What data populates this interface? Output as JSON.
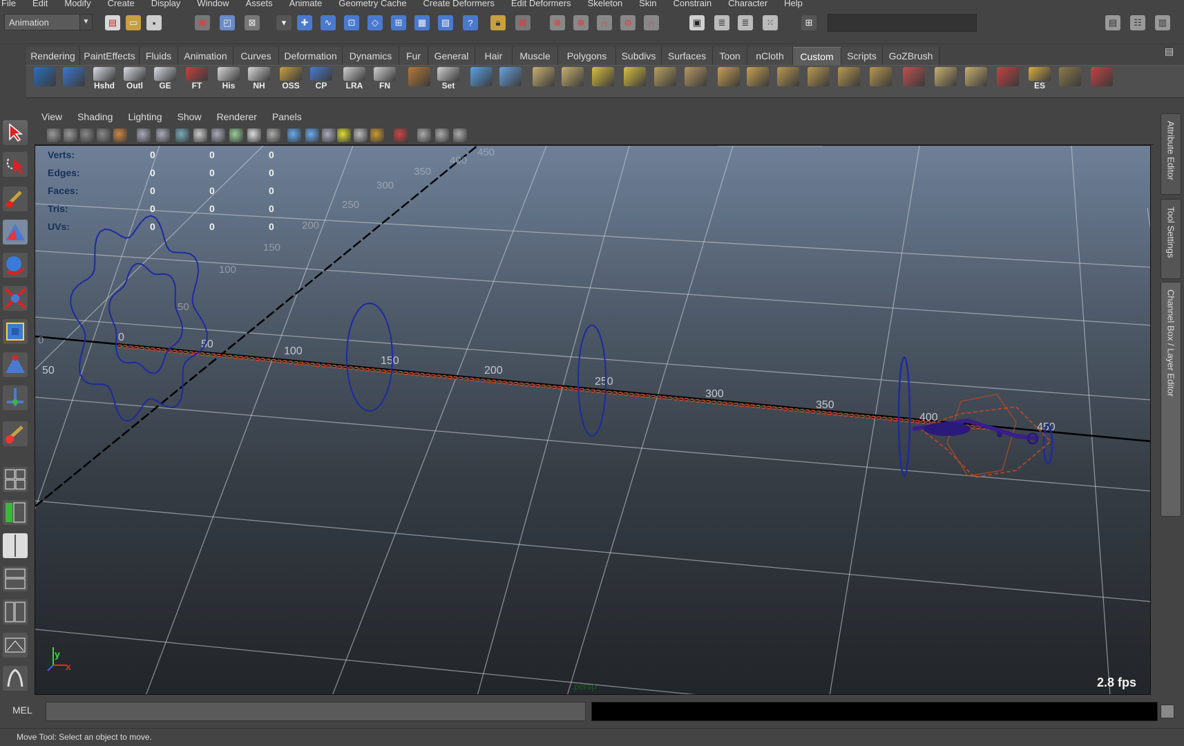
{
  "menubar": [
    "File",
    "Edit",
    "Modify",
    "Create",
    "Display",
    "Window",
    "Assets",
    "Animate",
    "Geometry Cache",
    "Create Deformers",
    "Edit Deformers",
    "Skeleton",
    "Skin",
    "Constrain",
    "Character",
    "Help"
  ],
  "status_line": {
    "menu_set": "Animation"
  },
  "shelf": {
    "tabs": [
      "Rendering",
      "PaintEffects",
      "Fluids",
      "Animation",
      "Curves",
      "Deformation",
      "Dynamics",
      "Fur",
      "General",
      "Hair",
      "Muscle",
      "Polygons",
      "Subdivs",
      "Surfaces",
      "Toon",
      "nCloth",
      "Custom",
      "Scripts",
      "GoZBrush"
    ],
    "active_tab": "Custom",
    "buttons": [
      {
        "label": "",
        "icon": "shelf-a-icon",
        "color": "#2a6fbf"
      },
      {
        "label": "",
        "icon": "checkmark-icon",
        "color": "#3a78d0"
      },
      {
        "label": "Hshd",
        "icon": "hypershade-icon",
        "color": "#d8dce4"
      },
      {
        "label": "Outl",
        "icon": "outliner-icon",
        "color": "#d8dce4"
      },
      {
        "label": "GE",
        "icon": "graph-editor-icon",
        "color": "#d8dce4"
      },
      {
        "label": "FT",
        "icon": "freeze-transform-icon",
        "color": "#c84040"
      },
      {
        "label": "His",
        "icon": "delete-history-icon",
        "color": "#d8d8d8"
      },
      {
        "label": "NH",
        "icon": "non-deformer-history-icon",
        "color": "#d8d8d8"
      },
      {
        "label": "OSS",
        "icon": "folder-icon",
        "color": "#c8a040"
      },
      {
        "label": "CP",
        "icon": "center-pivot-icon",
        "color": "#4a7ad0"
      },
      {
        "label": "LRA",
        "icon": "local-rotation-axes-icon",
        "color": "#d0d0d0"
      },
      {
        "label": "FN",
        "icon": "face-normals-icon",
        "color": "#d0d0d0"
      },
      {
        "label": "",
        "icon": "pivot-icon",
        "color": "#b87838"
      },
      {
        "label": "Set",
        "icon": "set-key-icon",
        "color": "#d0d0d0"
      },
      {
        "label": "",
        "icon": "joint-tool-icon",
        "color": "#5aa0e8"
      },
      {
        "label": "",
        "icon": "spheres-icon",
        "color": "#6aa0e0"
      },
      {
        "label": "",
        "icon": "poly-select-icon",
        "color": "#c8b070"
      },
      {
        "label": "",
        "icon": "poly-select-2-icon",
        "color": "#c8b070"
      },
      {
        "label": "",
        "icon": "poly-grid-icon",
        "color": "#d8c040"
      },
      {
        "label": "",
        "icon": "poly-grid-2-icon",
        "color": "#d8c040"
      },
      {
        "label": "",
        "icon": "poly-plane-icon",
        "color": "#b8a060"
      },
      {
        "label": "",
        "icon": "poly-edit-icon",
        "color": "#b89860"
      },
      {
        "label": "",
        "icon": "poly-extrude-icon",
        "color": "#c8a050"
      },
      {
        "label": "",
        "icon": "poly-wire-icon",
        "color": "#c8a050"
      },
      {
        "label": "",
        "icon": "poly-cube-icon",
        "color": "#b89850"
      },
      {
        "label": "",
        "icon": "poly-cube-2-icon",
        "color": "#b89850"
      },
      {
        "label": "",
        "icon": "poly-bevel-icon",
        "color": "#b89850"
      },
      {
        "label": "",
        "icon": "poly-bridge-icon",
        "color": "#b89850"
      },
      {
        "label": "",
        "icon": "poly-cone-icon",
        "color": "#c05050"
      },
      {
        "label": "",
        "icon": "poly-uv-icon",
        "color": "#c8b070"
      },
      {
        "label": "",
        "icon": "poly-split-icon",
        "color": "#c8b070"
      },
      {
        "label": "",
        "icon": "paint-brush-icon",
        "color": "#c84040"
      },
      {
        "label": "ES",
        "icon": "folder-icon",
        "color": "#d8b040"
      },
      {
        "label": "",
        "icon": "shaded-sphere-icon",
        "color": "#8a7a4a"
      },
      {
        "label": "",
        "icon": "constraint-icon",
        "color": "#c84040"
      }
    ]
  },
  "viewport": {
    "menu": [
      "View",
      "Shading",
      "Lighting",
      "Show",
      "Renderer",
      "Panels"
    ],
    "hud": [
      {
        "label": "Verts:",
        "values": [
          "0",
          "0",
          "0"
        ]
      },
      {
        "label": "Edges:",
        "values": [
          "0",
          "0",
          "0"
        ]
      },
      {
        "label": "Faces:",
        "values": [
          "0",
          "0",
          "0"
        ]
      },
      {
        "label": "Tris:",
        "values": [
          "0",
          "0",
          "0"
        ]
      },
      {
        "label": "UVs:",
        "values": [
          "0",
          "0",
          "0"
        ]
      }
    ],
    "fps": "2.8 fps",
    "camera": "persp",
    "axis_labels": {
      "y": "y",
      "x": "x"
    },
    "ruler_labels_main": [
      "0",
      "50",
      "100",
      "150",
      "200",
      "250",
      "300",
      "350",
      "400",
      "450"
    ],
    "ruler_labels_side": [
      "0",
      "50",
      "100",
      "150",
      "200",
      "250",
      "300",
      "350",
      "400",
      "450"
    ],
    "ruler_label_left": "50",
    "colors": {
      "curve": "#1e2aa0",
      "motion_path": "#c24a22",
      "axis_line": "#000000",
      "grid": "#c8cdd4",
      "hud_label": "#17305a"
    }
  },
  "side_tabs": [
    "Attribute Editor",
    "Tool Settings",
    "Channel Box / Layer Editor"
  ],
  "command_line": {
    "label": "MEL",
    "input": "",
    "result": ""
  },
  "help_line": "Move Tool: Select an object to move."
}
